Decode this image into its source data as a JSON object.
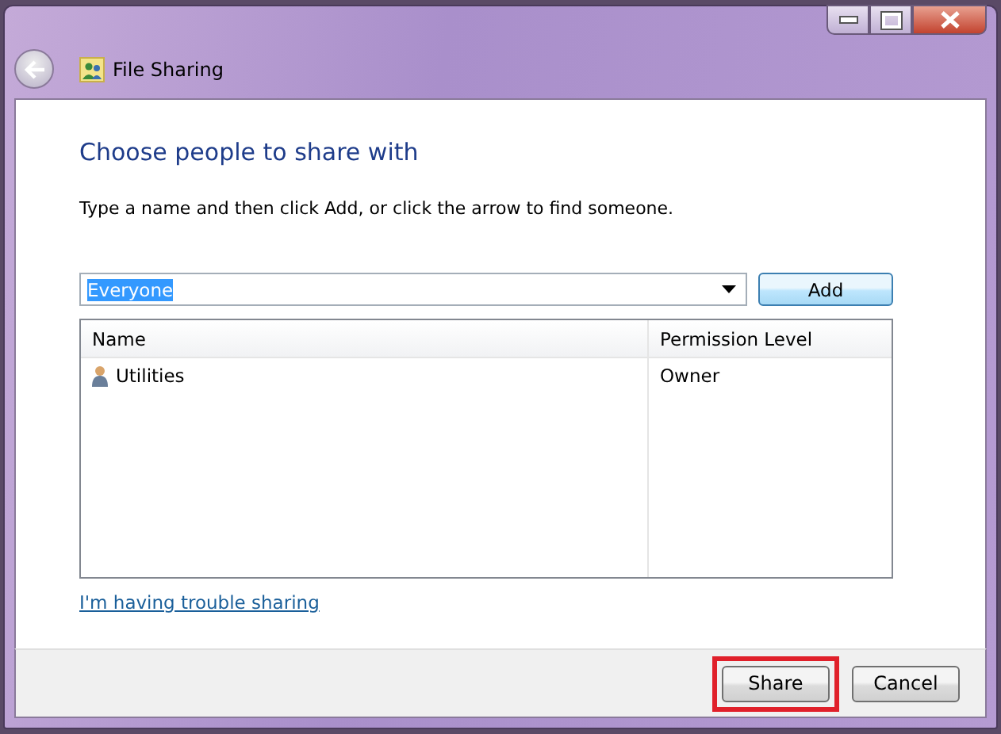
{
  "window": {
    "title": "File Sharing"
  },
  "heading": "Choose people to share with",
  "instruction": "Type a name and then click Add, or click the arrow to find someone.",
  "name_field": {
    "value": "Everyone",
    "text_selected": true
  },
  "add_button": "Add",
  "table": {
    "columns": [
      "Name",
      "Permission Level"
    ],
    "rows": [
      {
        "name": "Utilities",
        "permission": "Owner"
      }
    ]
  },
  "help_link": "I'm having trouble sharing",
  "buttons": [
    {
      "label": "Share",
      "highlighted": true
    },
    {
      "label": "Cancel",
      "highlighted": false
    }
  ]
}
